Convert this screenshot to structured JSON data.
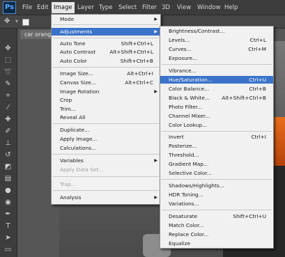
{
  "app": {
    "logo": "Ps"
  },
  "menubar": [
    "File",
    "Edit",
    "Image",
    "Layer",
    "Type",
    "Select",
    "Filter",
    "3D",
    "View",
    "Window",
    "Help"
  ],
  "document": {
    "tab_title": "car orange"
  },
  "image_menu": [
    {
      "label": "Mode",
      "submenu": true
    },
    {
      "label": "Adjustments",
      "submenu": true
    },
    {
      "label": "Auto Tone",
      "shortcut": "Shift+Ctrl+L"
    },
    {
      "label": "Auto Contrast",
      "shortcut": "Alt+Shift+Ctrl+L"
    },
    {
      "label": "Auto Color",
      "shortcut": "Shift+Ctrl+B"
    },
    {
      "label": "Image Size...",
      "shortcut": "Alt+Ctrl+I"
    },
    {
      "label": "Canvas Size...",
      "shortcut": "Alt+Ctrl+C"
    },
    {
      "label": "Image Rotation",
      "submenu": true
    },
    {
      "label": "Crop"
    },
    {
      "label": "Trim..."
    },
    {
      "label": "Reveal All"
    },
    {
      "label": "Duplicate..."
    },
    {
      "label": "Apply Image..."
    },
    {
      "label": "Calculations..."
    },
    {
      "label": "Variables",
      "submenu": true
    },
    {
      "label": "Apply Data Set...",
      "disabled": true
    },
    {
      "label": "Trap...",
      "disabled": true
    },
    {
      "label": "Analysis",
      "submenu": true
    }
  ],
  "adjustments_menu": [
    {
      "label": "Brightness/Contrast..."
    },
    {
      "label": "Levels...",
      "shortcut": "Ctrl+L"
    },
    {
      "label": "Curves...",
      "shortcut": "Ctrl+M"
    },
    {
      "label": "Exposure..."
    },
    {
      "label": "Vibrance..."
    },
    {
      "label": "Hue/Saturation...",
      "shortcut": "Ctrl+U"
    },
    {
      "label": "Color Balance...",
      "shortcut": "Ctrl+B"
    },
    {
      "label": "Black & White...",
      "shortcut": "Alt+Shift+Ctrl+B"
    },
    {
      "label": "Photo Filter..."
    },
    {
      "label": "Channel Mixer..."
    },
    {
      "label": "Color Lookup..."
    },
    {
      "label": "Invert",
      "shortcut": "Ctrl+I"
    },
    {
      "label": "Posterize..."
    },
    {
      "label": "Threshold..."
    },
    {
      "label": "Gradient Map..."
    },
    {
      "label": "Selective Color..."
    },
    {
      "label": "Shadows/Highlights..."
    },
    {
      "label": "HDR Toning..."
    },
    {
      "label": "Variations..."
    },
    {
      "label": "Desaturate",
      "shortcut": "Shift+Ctrl+U"
    },
    {
      "label": "Match Color..."
    },
    {
      "label": "Replace Color..."
    },
    {
      "label": "Equalize"
    }
  ],
  "colors": {
    "highlight": "#3a73c9",
    "menu_bg": "#f1f1f1",
    "workspace": "#565656"
  }
}
